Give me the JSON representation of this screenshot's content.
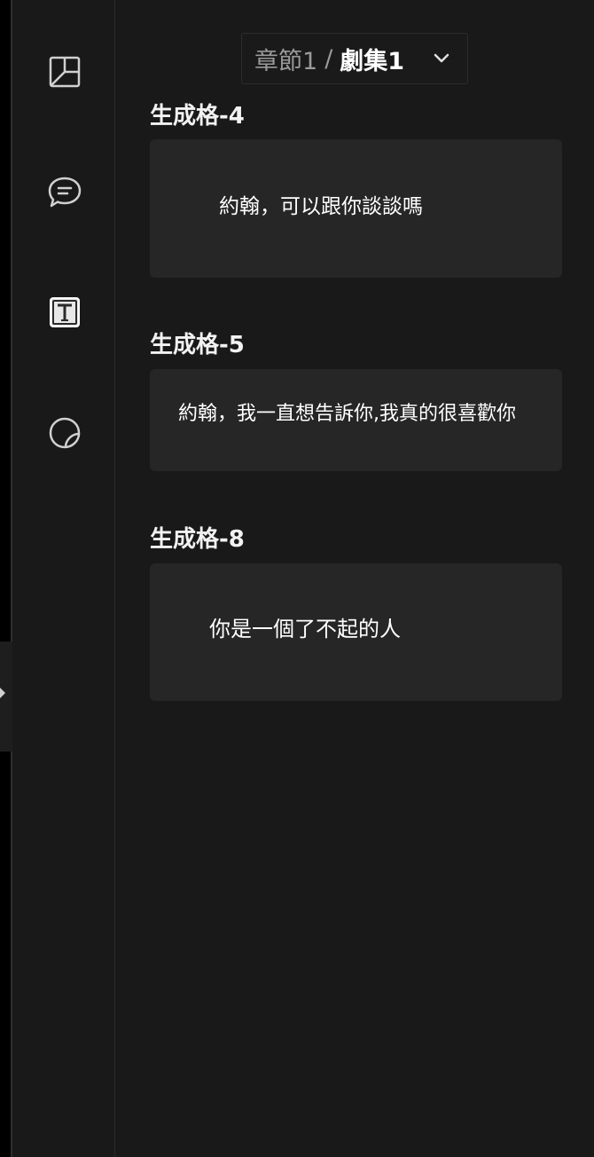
{
  "breadcrumb": {
    "chapter": "章節1",
    "separator": "/",
    "episode": "劇集1"
  },
  "rail": {
    "icons": [
      "storyboard-icon",
      "comment-bubble-icon",
      "text-box-icon",
      "sticker-icon"
    ]
  },
  "cells": [
    {
      "title": "生成格-4",
      "text": "約翰，可以跟你談談嗎"
    },
    {
      "title": "生成格-5",
      "text": "約翰，我一直想告訴你,我真的很喜歡你"
    },
    {
      "title": "生成格-8",
      "text": "你是一個了不起的人"
    }
  ],
  "colors": {
    "background": "#191919",
    "card": "#262626",
    "text": "#ffffff",
    "muted": "#9a9a9a"
  }
}
